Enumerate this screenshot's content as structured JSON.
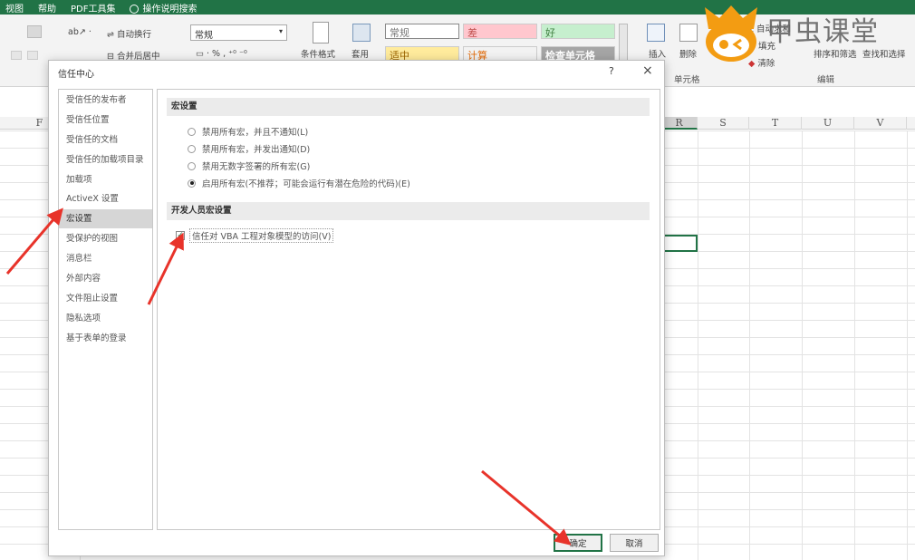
{
  "ribbon_tabs": [
    "视图",
    "帮助",
    "PDF工具集",
    "操作说明搜索"
  ],
  "ribbon": {
    "wrap_text": "自动换行",
    "merge_center": "合并后居中",
    "number_format": "常规",
    "percent": "%",
    "cond_format": "条件格式",
    "apply_table": "套用",
    "styles": {
      "normal": "常规",
      "bad": "差",
      "good": "好",
      "neutral": "适中",
      "calc": "计算",
      "check": "检查单元格"
    },
    "insert": "插入",
    "delete": "删除",
    "cells_group": "单元格",
    "autosum": "自动求和",
    "fill": "填充",
    "clear": "清除",
    "sort_filter": "排序和筛选",
    "find_select": "查找和选择",
    "edit_group": "编辑"
  },
  "watermark": {
    "text": "甲虫课堂"
  },
  "sheet": {
    "columns": [
      "F",
      "R",
      "S",
      "T",
      "U",
      "V"
    ]
  },
  "dialog": {
    "title": "信任中心",
    "help": "?",
    "close": "×",
    "nav": [
      "受信任的发布者",
      "受信任位置",
      "受信任的文档",
      "受信任的加载项目录",
      "加载项",
      "ActiveX 设置",
      "宏设置",
      "受保护的视图",
      "消息栏",
      "外部内容",
      "文件阻止设置",
      "隐私选项",
      "基于表单的登录"
    ],
    "active_nav_index": 6,
    "macro_section": "宏设置",
    "macro_options": [
      {
        "label": "禁用所有宏，并且不通知(L)",
        "selected": false
      },
      {
        "label": "禁用所有宏，并发出通知(D)",
        "selected": false
      },
      {
        "label": "禁用无数字签署的所有宏(G)",
        "selected": false
      },
      {
        "label": "启用所有宏(不推荐；可能会运行有潜在危险的代码)(E)",
        "selected": true
      }
    ],
    "dev_section": "开发人员宏设置",
    "trust_vba": {
      "label": "信任对 VBA 工程对象模型的访问(V)",
      "checked": true
    },
    "ok": "确定",
    "cancel": "取消"
  },
  "colors": {
    "accent": "#217346",
    "arrow": "#e8332a",
    "bad_bg": "#ffc7ce",
    "good_bg": "#c6efce",
    "neutral_bg": "#ffeb9c"
  }
}
